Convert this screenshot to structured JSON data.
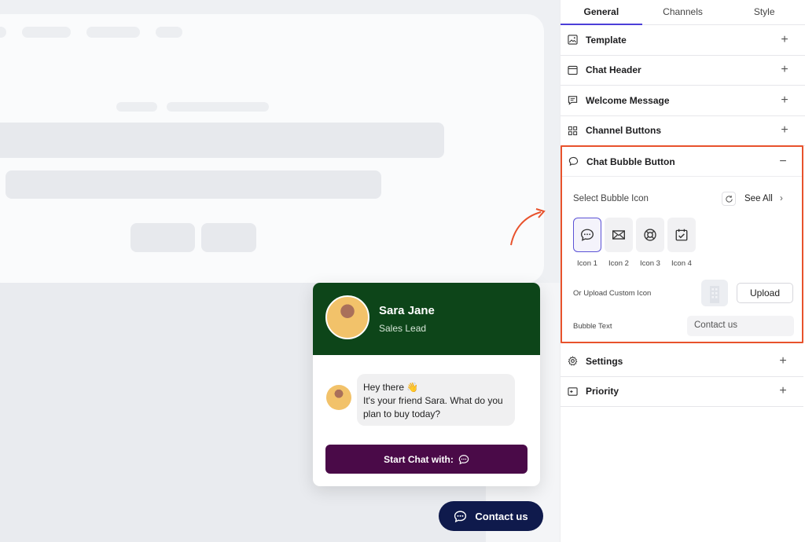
{
  "preview": {
    "agent_name": "Sara Jane",
    "agent_role": "Sales Lead",
    "message_line1": "Hey there 👋",
    "message_line2": "It's your friend Sara. What do you plan to buy today?",
    "start_button": "Start Chat with:",
    "launcher_text": "Contact us"
  },
  "tabs": [
    {
      "label": "General",
      "active": true
    },
    {
      "label": "Channels",
      "active": false
    },
    {
      "label": "Style",
      "active": false
    }
  ],
  "sections_top": [
    {
      "label": "Template",
      "icon": "image-icon",
      "toggle": "+"
    },
    {
      "label": "Chat Header",
      "icon": "window-icon",
      "toggle": "+"
    },
    {
      "label": "Welcome Message",
      "icon": "message-icon",
      "toggle": "+"
    },
    {
      "label": "Channel Buttons",
      "icon": "grid-icon",
      "toggle": "+"
    }
  ],
  "chat_bubble": {
    "label": "Chat Bubble Button",
    "icon": "speech-bubble-icon",
    "toggle": "−",
    "select_label": "Select Bubble Icon",
    "see_all": "See All",
    "icons": [
      {
        "label": "Icon 1",
        "icon": "chat-icon",
        "selected": true
      },
      {
        "label": "Icon 2",
        "icon": "envelope-icon",
        "selected": false
      },
      {
        "label": "Icon 3",
        "icon": "lifebuoy-icon",
        "selected": false
      },
      {
        "label": "Icon 4",
        "icon": "calendar-check-icon",
        "selected": false
      }
    ],
    "upload_label": "Or Upload Custom Icon",
    "upload_button": "Upload",
    "bubble_text_label": "Bubble Text",
    "bubble_text_value": "Contact us"
  },
  "sections_bottom": [
    {
      "label": "Settings",
      "icon": "gear-icon",
      "toggle": "+"
    },
    {
      "label": "Priority",
      "icon": "priority-icon",
      "toggle": "+"
    }
  ],
  "colors": {
    "header_green": "#0d4519",
    "start_button": "#4a0a48",
    "launcher": "#0f1a4c",
    "accent": "#4b3ed8",
    "highlight": "#e8522c"
  }
}
